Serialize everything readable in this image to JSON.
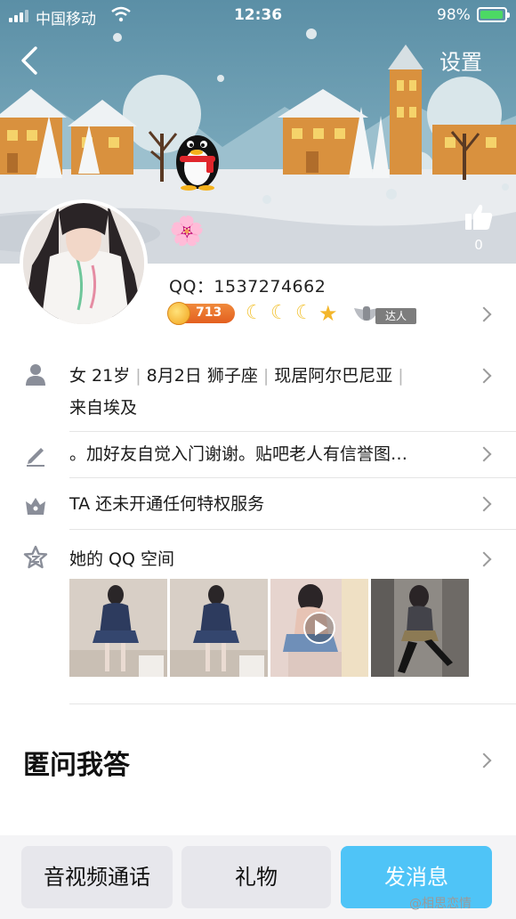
{
  "status_bar": {
    "carrier": "中国移动",
    "time": "12:36",
    "battery_percent": "98%",
    "battery_level": 0.98
  },
  "header": {
    "back_icon": "chevron-left-icon",
    "settings_label": "设置",
    "like_count": "0"
  },
  "profile": {
    "qq_label": "QQ：1537274662",
    "coin_count": "713",
    "level_icons": [
      "moon-icon",
      "moon-icon",
      "moon-icon",
      "star-icon"
    ],
    "talent_label": "达人"
  },
  "info": {
    "gender_age": "女 21岁",
    "birthday": "8月2日 狮子座",
    "location": "现居阿尔巴尼亚",
    "hometown": "来自埃及",
    "signature": "。加好友自觉入门谢谢。贴吧老人有信誉图…",
    "privilege": "TA 还未开通任何特权服务",
    "qzone": "她的 QQ 空间"
  },
  "section": {
    "title": "匿问我答"
  },
  "bottom_bar": {
    "call_label": "音视频通话",
    "gift_label": "礼物",
    "message_label": "发消息"
  },
  "watermark": "@相思恋情",
  "colors": {
    "accent": "#4fc4f7",
    "coin": "#e35f1f",
    "divider": "#e5e5e5"
  }
}
